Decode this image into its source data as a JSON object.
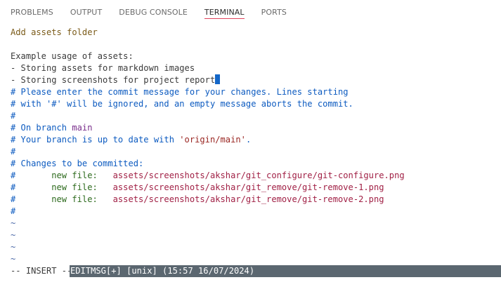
{
  "tabs": [
    {
      "label": "PROBLEMS"
    },
    {
      "label": "OUTPUT"
    },
    {
      "label": "DEBUG CONSOLE"
    },
    {
      "label": "TERMINAL",
      "active": true
    },
    {
      "label": "PORTS"
    }
  ],
  "editor": {
    "commit_message": "Add assets folder",
    "usage_heading": "Example usage of assets:",
    "usage_items": [
      "- Storing assets for markdown images",
      "- Storing screenshots for project report"
    ],
    "comment_lines": [
      "# Please enter the commit message for your changes. Lines starting",
      "# with '#' will be ignored, and an empty message aborts the commit.",
      "#"
    ],
    "branch_prefix": "# On branch ",
    "branch_name": "main",
    "up_to_date_prefix": "# Your branch is up to date with ",
    "upstream": "'origin/main'",
    "up_to_date_suffix": ".",
    "hash": "#",
    "changes_heading": "# Changes to be committed:",
    "new_file_label": "new file:",
    "staged_files": [
      "assets/screenshots/akshar/git_configure/git-configure.png",
      "assets/screenshots/akshar/git_remove/git-remove-1.png",
      "assets/screenshots/akshar/git_remove/git-remove-2.png"
    ],
    "tilde": "~"
  },
  "status": {
    "mode": "-- INSERT --",
    "file_info": "EDITMSG[+] [unix] (15:57 16/07/2024)"
  },
  "colors": {
    "commit_message": "#7a5a18",
    "comment": "#0d5bc0",
    "branch": "#7a2f8c",
    "upstream": "#9a2622",
    "new_file_label": "#2e6b1e",
    "file_path": "#a01f44",
    "tilde": "#4a68a8",
    "cursor": "#1467c8",
    "active_tab_underline": "#e0435c",
    "status_bar_bg": "#5b6770"
  }
}
